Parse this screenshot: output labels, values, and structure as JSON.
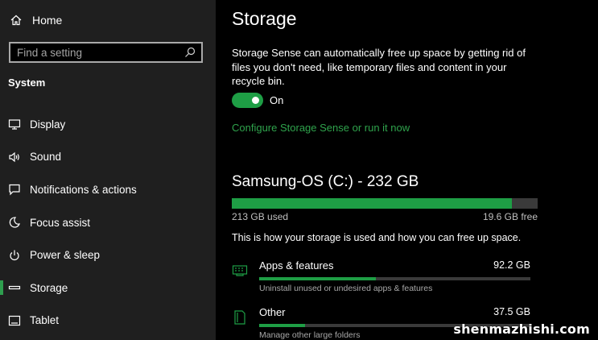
{
  "sidebar": {
    "home_label": "Home",
    "search_placeholder": "Find a setting",
    "section_title": "System",
    "items": [
      {
        "label": "Display",
        "icon": "display-icon"
      },
      {
        "label": "Sound",
        "icon": "sound-icon"
      },
      {
        "label": "Notifications & actions",
        "icon": "notifications-icon"
      },
      {
        "label": "Focus assist",
        "icon": "focus-assist-icon"
      },
      {
        "label": "Power & sleep",
        "icon": "power-icon"
      },
      {
        "label": "Storage",
        "icon": "storage-icon",
        "active": true
      },
      {
        "label": "Tablet",
        "icon": "tablet-icon"
      }
    ]
  },
  "main": {
    "title": "Storage",
    "description": "Storage Sense can automatically free up space by getting rid of files you don't need, like temporary files and content in your recycle bin.",
    "toggle_state": "On",
    "toggle_on": true,
    "configure_link": "Configure Storage Sense or run it now",
    "drive": {
      "title": "Samsung-OS (C:) - 232 GB",
      "used_fraction": 0.917,
      "used_label": "213 GB used",
      "free_label": "19.6 GB free"
    },
    "usage_description": "This is how your storage is used and how you can free up space.",
    "categories": [
      {
        "name": "Apps & features",
        "size": "92.2 GB",
        "subtext": "Uninstall unused or undesired apps & features",
        "fraction": 0.43,
        "icon": "apps-features-icon"
      },
      {
        "name": "Other",
        "size": "37.5 GB",
        "subtext": "Manage other large folders",
        "fraction": 0.17,
        "icon": "other-files-icon"
      }
    ]
  },
  "watermark": "shenmazhishi.com",
  "colors": {
    "accent": "#1e9e45",
    "link": "#2fa34c",
    "sidebar_bg": "#1f1f1f",
    "main_bg": "#000000"
  }
}
